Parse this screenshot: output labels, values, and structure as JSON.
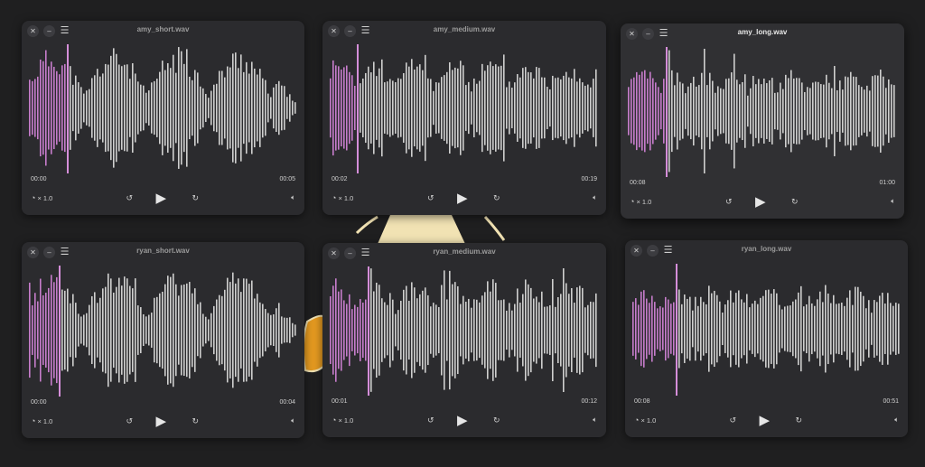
{
  "windows": [
    {
      "id": "amy_short",
      "title": "amy_short.wav",
      "time_current": "00:00",
      "time_total": "00:05",
      "speed": "× 1.0",
      "progress": 0.15,
      "seed": 11,
      "envelope": "short"
    },
    {
      "id": "amy_medium",
      "title": "amy_medium.wav",
      "time_current": "00:02",
      "time_total": "00:19",
      "speed": "× 1.0",
      "progress": 0.11,
      "seed": 23,
      "envelope": "medium"
    },
    {
      "id": "amy_long",
      "title": "amy_long.wav",
      "time_current": "00:08",
      "time_total": "01:00",
      "speed": "× 1.0",
      "progress": 0.15,
      "seed": 37,
      "envelope": "long"
    },
    {
      "id": "ryan_short",
      "title": "ryan_short.wav",
      "time_current": "00:00",
      "time_total": "00:04",
      "speed": "× 1.0",
      "progress": 0.12,
      "seed": 41,
      "envelope": "short"
    },
    {
      "id": "ryan_medium",
      "title": "ryan_medium.wav",
      "time_current": "00:01",
      "time_total": "00:12",
      "speed": "× 1.0",
      "progress": 0.15,
      "seed": 53,
      "envelope": "medium"
    },
    {
      "id": "ryan_long",
      "title": "ryan_long.wav",
      "time_current": "00:08",
      "time_total": "00:51",
      "speed": "× 1.0",
      "progress": 0.17,
      "seed": 67,
      "envelope": "long"
    }
  ],
  "icons": {
    "close": "close-icon",
    "minimize": "minimize-icon",
    "menu": "menu-icon",
    "speed": "speedometer-icon",
    "rewind": "rewind-icon",
    "play": "play-icon",
    "forward": "fast-forward-icon",
    "volume": "volume-icon"
  },
  "colors": {
    "played": "#c77dcc",
    "unplayed": "#cfcfcf",
    "accent": "#d58ed9",
    "window": "#2b2b2e",
    "desktop": "#1f1f20"
  }
}
